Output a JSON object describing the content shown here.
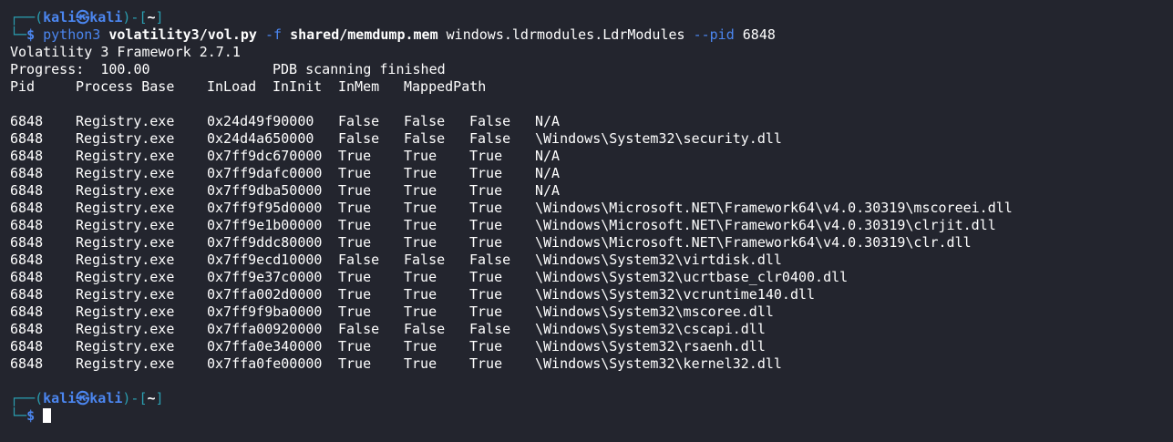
{
  "prompt": {
    "box_top": "┌──(",
    "user": "kali",
    "at": "㉿",
    "host": "kali",
    "sep": ")-[",
    "dir": "~",
    "close": "]",
    "box_bottom": "└─",
    "dollar": "$"
  },
  "command": {
    "program": "python3",
    "script": "volatility3/vol.py",
    "flag_f": "-f",
    "file": "shared/memdump.mem",
    "plugin": "windows.ldrmodules.LdrModules",
    "flag_pid": "--pid",
    "pid": "6848"
  },
  "output": {
    "framework": "Volatility 3 Framework 2.7.1",
    "progress_label": "Progress:  100.00",
    "progress_status": "PDB scanning finished"
  },
  "table": {
    "headers": [
      "Pid",
      "Process Base",
      "InLoad",
      "InInit",
      "InMem",
      "MappedPath"
    ],
    "rows": [
      [
        "6848",
        "Registry.exe",
        "0x24d49f90000",
        "False",
        "False",
        "False",
        "N/A"
      ],
      [
        "6848",
        "Registry.exe",
        "0x24d4a650000",
        "False",
        "False",
        "False",
        "\\Windows\\System32\\security.dll"
      ],
      [
        "6848",
        "Registry.exe",
        "0x7ff9dc670000",
        "True",
        "True",
        "True",
        "N/A"
      ],
      [
        "6848",
        "Registry.exe",
        "0x7ff9dafc0000",
        "True",
        "True",
        "True",
        "N/A"
      ],
      [
        "6848",
        "Registry.exe",
        "0x7ff9dba50000",
        "True",
        "True",
        "True",
        "N/A"
      ],
      [
        "6848",
        "Registry.exe",
        "0x7ff9f95d0000",
        "True",
        "True",
        "True",
        "\\Windows\\Microsoft.NET\\Framework64\\v4.0.30319\\mscoreei.dll"
      ],
      [
        "6848",
        "Registry.exe",
        "0x7ff9e1b00000",
        "True",
        "True",
        "True",
        "\\Windows\\Microsoft.NET\\Framework64\\v4.0.30319\\clrjit.dll"
      ],
      [
        "6848",
        "Registry.exe",
        "0x7ff9ddc80000",
        "True",
        "True",
        "True",
        "\\Windows\\Microsoft.NET\\Framework64\\v4.0.30319\\clr.dll"
      ],
      [
        "6848",
        "Registry.exe",
        "0x7ff9ecd10000",
        "False",
        "False",
        "False",
        "\\Windows\\System32\\virtdisk.dll"
      ],
      [
        "6848",
        "Registry.exe",
        "0x7ff9e37c0000",
        "True",
        "True",
        "True",
        "\\Windows\\System32\\ucrtbase_clr0400.dll"
      ],
      [
        "6848",
        "Registry.exe",
        "0x7ffa002d0000",
        "True",
        "True",
        "True",
        "\\Windows\\System32\\vcruntime140.dll"
      ],
      [
        "6848",
        "Registry.exe",
        "0x7ff9f9ba0000",
        "True",
        "True",
        "True",
        "\\Windows\\System32\\mscoree.dll"
      ],
      [
        "6848",
        "Registry.exe",
        "0x7ffa00920000",
        "False",
        "False",
        "False",
        "\\Windows\\System32\\cscapi.dll"
      ],
      [
        "6848",
        "Registry.exe",
        "0x7ffa0e340000",
        "True",
        "True",
        "True",
        "\\Windows\\System32\\rsaenh.dll"
      ],
      [
        "6848",
        "Registry.exe",
        "0x7ffa0fe00000",
        "True",
        "True",
        "True",
        "\\Windows\\System32\\kernel32.dll"
      ]
    ]
  },
  "colors": {
    "background": "#23252e",
    "prompt_frame": "#2a9eb0",
    "prompt_user": "#4b86f0",
    "text": "#ffffff"
  }
}
